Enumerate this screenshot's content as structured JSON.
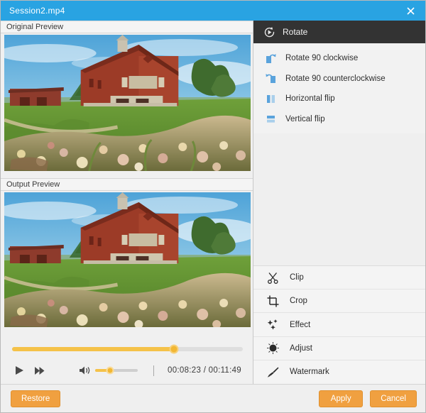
{
  "window": {
    "title": "Session2.mp4",
    "close_icon": "close-icon",
    "titlebar_color": "#29a3e2"
  },
  "left_panel": {
    "original_preview_label": "Original Preview",
    "output_preview_label": "Output Preview",
    "preview_image_description": "Red brick barn with cupola on a green lawn behind a bed of blooming lilies under a blue sky"
  },
  "transport": {
    "play_icon": "play-icon",
    "fast_forward_icon": "fast-forward-icon",
    "volume_icon": "speaker-icon",
    "progress_percent": 70,
    "volume_percent": 35,
    "current_time": "00:08:23",
    "separator": "/",
    "total_time": "00:11:49",
    "time_display": "00:08:23 / 00:11:49",
    "accent_color": "#f5c249"
  },
  "right_panel": {
    "section_title": "Rotate",
    "section_icon": "rotate-circle-icon",
    "rotate_options": [
      {
        "label": "Rotate 90 clockwise",
        "icon": "rotate-clockwise-icon"
      },
      {
        "label": "Rotate 90 counterclockwise",
        "icon": "rotate-counterclockwise-icon"
      },
      {
        "label": "Horizontal flip",
        "icon": "horizontal-flip-icon"
      },
      {
        "label": "Vertical flip",
        "icon": "vertical-flip-icon"
      }
    ],
    "tools": [
      {
        "label": "Clip",
        "icon": "scissors-icon"
      },
      {
        "label": "Crop",
        "icon": "crop-icon"
      },
      {
        "label": "Effect",
        "icon": "sparkles-icon"
      },
      {
        "label": "Adjust",
        "icon": "brightness-icon"
      },
      {
        "label": "Watermark",
        "icon": "brush-icon"
      }
    ],
    "icon_color": "#4a9fd8",
    "header_bg": "#333333"
  },
  "footer": {
    "restore_label": "Restore",
    "apply_label": "Apply",
    "cancel_label": "Cancel",
    "button_color": "#f0a040"
  }
}
